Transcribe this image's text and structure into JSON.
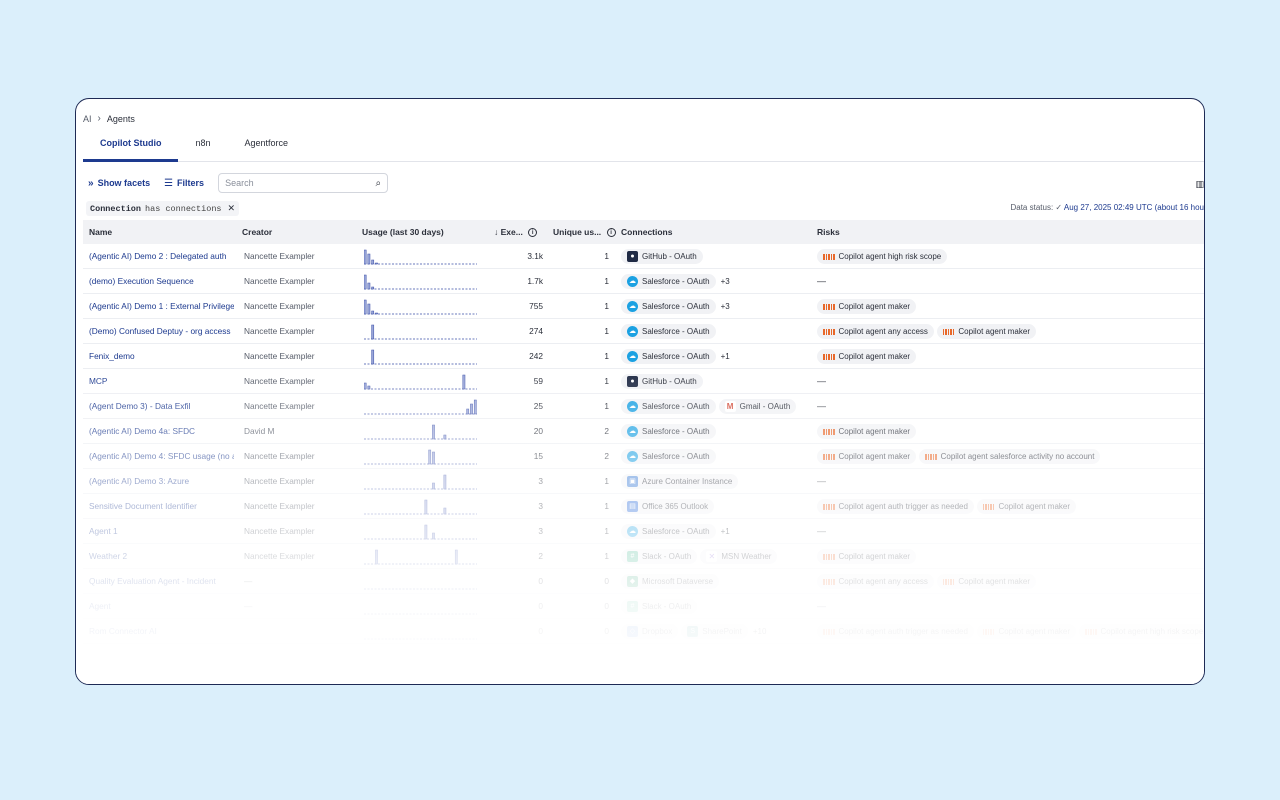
{
  "breadcrumb": {
    "root": "AI",
    "current": "Agents"
  },
  "tabs": [
    "Copilot Studio",
    "n8n",
    "Agentforce"
  ],
  "toolbar": {
    "show_facets": "Show facets",
    "filters": "Filters",
    "search_placeholder": "Search"
  },
  "filter_chip": {
    "key": "Connection",
    "value": "has connections"
  },
  "data_status": {
    "label": "Data status:",
    "timestamp": "Aug 27, 2025 02:49 UTC (about 16 hou"
  },
  "columns": {
    "name": "Name",
    "creator": "Creator",
    "usage": "Usage (last 30 days)",
    "exec": "Exe...",
    "unique": "Unique us...",
    "connections": "Connections",
    "risks": "Risks"
  },
  "colors": {
    "accent": "#1d3a8f",
    "risk_bar": "#e8682a",
    "spark": "#3a4fa8"
  },
  "rows": [
    {
      "name": "(Agentic AI) Demo 2 : Delegated auth",
      "creator": "Nancette Exampler",
      "usage": [
        14,
        10,
        4,
        1,
        0,
        0,
        0,
        0,
        0,
        0,
        0,
        0,
        0,
        0,
        0,
        0,
        0,
        0,
        0,
        0,
        0,
        0,
        0,
        0,
        0,
        0,
        0,
        0,
        0,
        0
      ],
      "exec": "3.1k",
      "unique": "1",
      "connections": [
        {
          "icon": "github",
          "label": "GitHub - OAuth"
        }
      ],
      "conn_extra": "",
      "risks": [
        "Copilot agent high risk scope"
      ]
    },
    {
      "name": "(demo) Execution Sequence",
      "creator": "Nancette Exampler",
      "usage": [
        14,
        6,
        2,
        0,
        0,
        0,
        0,
        0,
        0,
        0,
        0,
        0,
        0,
        0,
        0,
        0,
        0,
        0,
        0,
        0,
        0,
        0,
        0,
        0,
        0,
        0,
        0,
        0,
        0,
        0
      ],
      "exec": "1.7k",
      "unique": "1",
      "connections": [
        {
          "icon": "salesforce",
          "label": "Salesforce - OAuth"
        }
      ],
      "conn_extra": "+3",
      "risks": []
    },
    {
      "name": "(Agentic AI) Demo 1 : External Privilege",
      "creator": "Nancette Exampler",
      "usage": [
        14,
        10,
        3,
        1,
        0,
        0,
        0,
        0,
        0,
        0,
        0,
        0,
        0,
        0,
        0,
        0,
        0,
        0,
        0,
        0,
        0,
        0,
        0,
        0,
        0,
        0,
        0,
        0,
        0,
        0
      ],
      "exec": "755",
      "unique": "1",
      "connections": [
        {
          "icon": "salesforce",
          "label": "Salesforce - OAuth"
        }
      ],
      "conn_extra": "+3",
      "risks": [
        "Copilot agent maker"
      ]
    },
    {
      "name": "(Demo) Confused Deptuy - org access",
      "creator": "Nancette Exampler",
      "usage": [
        0,
        0,
        14,
        0,
        0,
        0,
        0,
        0,
        0,
        0,
        0,
        0,
        0,
        0,
        0,
        0,
        0,
        0,
        0,
        0,
        0,
        0,
        0,
        0,
        0,
        0,
        0,
        0,
        0,
        0
      ],
      "exec": "274",
      "unique": "1",
      "connections": [
        {
          "icon": "salesforce",
          "label": "Salesforce - OAuth"
        }
      ],
      "conn_extra": "",
      "risks": [
        "Copilot agent any access",
        "Copilot agent maker"
      ]
    },
    {
      "name": "Fenix_demo",
      "creator": "Nancette Exampler",
      "usage": [
        0,
        0,
        14,
        0,
        0,
        0,
        0,
        0,
        0,
        0,
        0,
        0,
        0,
        0,
        0,
        0,
        0,
        0,
        0,
        0,
        0,
        0,
        0,
        0,
        0,
        0,
        0,
        0,
        0,
        0
      ],
      "exec": "242",
      "unique": "1",
      "connections": [
        {
          "icon": "salesforce",
          "label": "Salesforce - OAuth"
        }
      ],
      "conn_extra": "+1",
      "risks": [
        "Copilot agent maker"
      ]
    },
    {
      "name": "MCP",
      "creator": "Nancette Exampler",
      "usage": [
        6,
        3,
        0,
        0,
        0,
        0,
        0,
        0,
        0,
        0,
        0,
        0,
        0,
        0,
        0,
        0,
        0,
        0,
        0,
        0,
        0,
        0,
        0,
        0,
        0,
        0,
        14,
        0,
        0,
        0
      ],
      "exec": "59",
      "unique": "1",
      "connections": [
        {
          "icon": "github",
          "label": "GitHub - OAuth"
        }
      ],
      "conn_extra": "",
      "risks": []
    },
    {
      "name": "(Agent Demo 3) - Data Exfil",
      "creator": "Nancette Exampler",
      "usage": [
        0,
        0,
        0,
        0,
        0,
        0,
        0,
        0,
        0,
        0,
        0,
        0,
        0,
        0,
        0,
        0,
        0,
        0,
        0,
        0,
        0,
        0,
        0,
        0,
        0,
        0,
        0,
        5,
        10,
        14
      ],
      "exec": "25",
      "unique": "1",
      "connections": [
        {
          "icon": "salesforce",
          "label": "Salesforce - OAuth"
        },
        {
          "icon": "gmail",
          "label": "Gmail - OAuth"
        }
      ],
      "conn_extra": "",
      "risks": []
    },
    {
      "name": "(Agentic AI) Demo 4a: SFDC",
      "creator": "David M",
      "usage": [
        0,
        0,
        0,
        0,
        0,
        0,
        0,
        0,
        0,
        0,
        0,
        0,
        0,
        0,
        0,
        0,
        0,
        0,
        14,
        0,
        0,
        4,
        0,
        0,
        0,
        0,
        0,
        0,
        0,
        0
      ],
      "exec": "20",
      "unique": "2",
      "connections": [
        {
          "icon": "salesforce",
          "label": "Salesforce - OAuth"
        }
      ],
      "conn_extra": "",
      "risks": [
        "Copilot agent maker"
      ]
    },
    {
      "name": "(Agentic AI) Demo 4: SFDC usage (no acnt)",
      "creator": "Nancette Exampler",
      "usage": [
        0,
        0,
        0,
        0,
        0,
        0,
        0,
        0,
        0,
        0,
        0,
        0,
        0,
        0,
        0,
        0,
        0,
        14,
        12,
        0,
        0,
        0,
        0,
        0,
        0,
        0,
        0,
        0,
        0,
        0
      ],
      "exec": "15",
      "unique": "2",
      "connections": [
        {
          "icon": "salesforce",
          "label": "Salesforce - OAuth"
        }
      ],
      "conn_extra": "",
      "risks": [
        "Copilot agent maker",
        "Copilot agent salesforce activity no account"
      ]
    },
    {
      "name": "(Agentic AI) Demo 3: Azure",
      "creator": "Nancette Exampler",
      "usage": [
        0,
        0,
        0,
        0,
        0,
        0,
        0,
        0,
        0,
        0,
        0,
        0,
        0,
        0,
        0,
        0,
        0,
        0,
        6,
        0,
        0,
        14,
        0,
        0,
        0,
        0,
        0,
        0,
        0,
        0
      ],
      "exec": "3",
      "unique": "1",
      "connections": [
        {
          "icon": "azure",
          "label": "Azure Container Instance"
        }
      ],
      "conn_extra": "",
      "risks": []
    },
    {
      "name": "Sensitive Document Identifier",
      "creator": "Nancette Exampler",
      "usage": [
        0,
        0,
        0,
        0,
        0,
        0,
        0,
        0,
        0,
        0,
        0,
        0,
        0,
        0,
        0,
        0,
        14,
        0,
        0,
        0,
        0,
        6,
        0,
        0,
        0,
        0,
        0,
        0,
        0,
        0
      ],
      "exec": "3",
      "unique": "1",
      "connections": [
        {
          "icon": "office",
          "label": "Office 365 Outlook"
        }
      ],
      "conn_extra": "",
      "risks": [
        "Copilot agent auth trigger as needed",
        "Copilot agent maker"
      ]
    },
    {
      "name": "Agent 1",
      "creator": "Nancette Exampler",
      "usage": [
        0,
        0,
        0,
        0,
        0,
        0,
        0,
        0,
        0,
        0,
        0,
        0,
        0,
        0,
        0,
        0,
        14,
        0,
        6,
        0,
        0,
        0,
        0,
        0,
        0,
        0,
        0,
        0,
        0,
        0
      ],
      "exec": "3",
      "unique": "1",
      "connections": [
        {
          "icon": "salesforce",
          "label": "Salesforce - OAuth"
        }
      ],
      "conn_extra": "+1",
      "risks": []
    },
    {
      "name": "Weather 2",
      "creator": "Nancette Exampler",
      "usage": [
        0,
        0,
        0,
        14,
        0,
        0,
        0,
        0,
        0,
        0,
        0,
        0,
        0,
        0,
        0,
        0,
        0,
        0,
        0,
        0,
        0,
        0,
        0,
        0,
        14,
        0,
        0,
        0,
        0,
        0
      ],
      "exec": "2",
      "unique": "1",
      "connections": [
        {
          "icon": "slack",
          "label": "Slack - OAuth"
        },
        {
          "icon": "msn",
          "label": "MSN Weather"
        }
      ],
      "conn_extra": "",
      "risks": [
        "Copilot agent maker"
      ]
    },
    {
      "name": "Quality Evaluation Agent - Incident",
      "creator": "—",
      "usage": [
        0,
        0,
        0,
        0,
        0,
        0,
        0,
        0,
        0,
        0,
        0,
        0,
        0,
        0,
        0,
        0,
        0,
        0,
        0,
        0,
        0,
        0,
        0,
        0,
        0,
        0,
        0,
        0,
        0,
        0
      ],
      "exec": "0",
      "unique": "0",
      "connections": [
        {
          "icon": "dataverse",
          "label": "Microsoft Dataverse"
        }
      ],
      "conn_extra": "",
      "risks": [
        "Copilot agent any access",
        "Copilot agent maker"
      ]
    },
    {
      "name": "Agent",
      "creator": "—",
      "usage": [
        0,
        0,
        0,
        0,
        0,
        0,
        0,
        0,
        0,
        0,
        0,
        0,
        0,
        0,
        0,
        0,
        0,
        0,
        0,
        0,
        0,
        0,
        0,
        0,
        0,
        0,
        0,
        0,
        0,
        0
      ],
      "exec": "0",
      "unique": "0",
      "connections": [
        {
          "icon": "slack",
          "label": "Slack - OAuth"
        }
      ],
      "conn_extra": "",
      "risks": []
    },
    {
      "name": "Rom Connector AI",
      "creator": "",
      "usage": [
        0,
        0,
        0,
        0,
        0,
        0,
        0,
        0,
        0,
        0,
        0,
        0,
        0,
        0,
        0,
        0,
        0,
        0,
        0,
        0,
        0,
        0,
        0,
        0,
        0,
        0,
        0,
        0,
        0,
        0
      ],
      "exec": "0",
      "unique": "0",
      "connections": [
        {
          "icon": "dropbox",
          "label": "Dropbox"
        },
        {
          "icon": "sharepoint",
          "label": "SharePoint"
        }
      ],
      "conn_extra": "+10",
      "risks": [
        "Copilot agent auth trigger as needed",
        "Copilot agent maker",
        "Copilot agent high risk scope"
      ]
    }
  ]
}
